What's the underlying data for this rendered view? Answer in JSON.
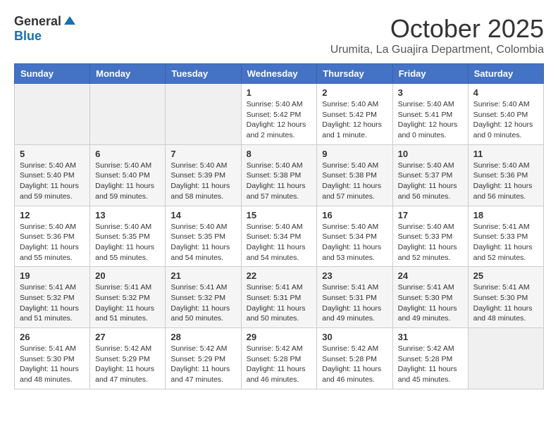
{
  "header": {
    "logo_general": "General",
    "logo_blue": "Blue",
    "month_title": "October 2025",
    "location": "Urumita, La Guajira Department, Colombia"
  },
  "weekdays": [
    "Sunday",
    "Monday",
    "Tuesday",
    "Wednesday",
    "Thursday",
    "Friday",
    "Saturday"
  ],
  "weeks": [
    [
      {
        "day": "",
        "info": ""
      },
      {
        "day": "",
        "info": ""
      },
      {
        "day": "",
        "info": ""
      },
      {
        "day": "1",
        "info": "Sunrise: 5:40 AM\nSunset: 5:42 PM\nDaylight: 12 hours\nand 2 minutes."
      },
      {
        "day": "2",
        "info": "Sunrise: 5:40 AM\nSunset: 5:42 PM\nDaylight: 12 hours\nand 1 minute."
      },
      {
        "day": "3",
        "info": "Sunrise: 5:40 AM\nSunset: 5:41 PM\nDaylight: 12 hours\nand 0 minutes."
      },
      {
        "day": "4",
        "info": "Sunrise: 5:40 AM\nSunset: 5:40 PM\nDaylight: 12 hours\nand 0 minutes."
      }
    ],
    [
      {
        "day": "5",
        "info": "Sunrise: 5:40 AM\nSunset: 5:40 PM\nDaylight: 11 hours\nand 59 minutes."
      },
      {
        "day": "6",
        "info": "Sunrise: 5:40 AM\nSunset: 5:40 PM\nDaylight: 11 hours\nand 59 minutes."
      },
      {
        "day": "7",
        "info": "Sunrise: 5:40 AM\nSunset: 5:39 PM\nDaylight: 11 hours\nand 58 minutes."
      },
      {
        "day": "8",
        "info": "Sunrise: 5:40 AM\nSunset: 5:38 PM\nDaylight: 11 hours\nand 57 minutes."
      },
      {
        "day": "9",
        "info": "Sunrise: 5:40 AM\nSunset: 5:38 PM\nDaylight: 11 hours\nand 57 minutes."
      },
      {
        "day": "10",
        "info": "Sunrise: 5:40 AM\nSunset: 5:37 PM\nDaylight: 11 hours\nand 56 minutes."
      },
      {
        "day": "11",
        "info": "Sunrise: 5:40 AM\nSunset: 5:36 PM\nDaylight: 11 hours\nand 56 minutes."
      }
    ],
    [
      {
        "day": "12",
        "info": "Sunrise: 5:40 AM\nSunset: 5:36 PM\nDaylight: 11 hours\nand 55 minutes."
      },
      {
        "day": "13",
        "info": "Sunrise: 5:40 AM\nSunset: 5:35 PM\nDaylight: 11 hours\nand 55 minutes."
      },
      {
        "day": "14",
        "info": "Sunrise: 5:40 AM\nSunset: 5:35 PM\nDaylight: 11 hours\nand 54 minutes."
      },
      {
        "day": "15",
        "info": "Sunrise: 5:40 AM\nSunset: 5:34 PM\nDaylight: 11 hours\nand 54 minutes."
      },
      {
        "day": "16",
        "info": "Sunrise: 5:40 AM\nSunset: 5:34 PM\nDaylight: 11 hours\nand 53 minutes."
      },
      {
        "day": "17",
        "info": "Sunrise: 5:40 AM\nSunset: 5:33 PM\nDaylight: 11 hours\nand 52 minutes."
      },
      {
        "day": "18",
        "info": "Sunrise: 5:41 AM\nSunset: 5:33 PM\nDaylight: 11 hours\nand 52 minutes."
      }
    ],
    [
      {
        "day": "19",
        "info": "Sunrise: 5:41 AM\nSunset: 5:32 PM\nDaylight: 11 hours\nand 51 minutes."
      },
      {
        "day": "20",
        "info": "Sunrise: 5:41 AM\nSunset: 5:32 PM\nDaylight: 11 hours\nand 51 minutes."
      },
      {
        "day": "21",
        "info": "Sunrise: 5:41 AM\nSunset: 5:32 PM\nDaylight: 11 hours\nand 50 minutes."
      },
      {
        "day": "22",
        "info": "Sunrise: 5:41 AM\nSunset: 5:31 PM\nDaylight: 11 hours\nand 50 minutes."
      },
      {
        "day": "23",
        "info": "Sunrise: 5:41 AM\nSunset: 5:31 PM\nDaylight: 11 hours\nand 49 minutes."
      },
      {
        "day": "24",
        "info": "Sunrise: 5:41 AM\nSunset: 5:30 PM\nDaylight: 11 hours\nand 49 minutes."
      },
      {
        "day": "25",
        "info": "Sunrise: 5:41 AM\nSunset: 5:30 PM\nDaylight: 11 hours\nand 48 minutes."
      }
    ],
    [
      {
        "day": "26",
        "info": "Sunrise: 5:41 AM\nSunset: 5:30 PM\nDaylight: 11 hours\nand 48 minutes."
      },
      {
        "day": "27",
        "info": "Sunrise: 5:42 AM\nSunset: 5:29 PM\nDaylight: 11 hours\nand 47 minutes."
      },
      {
        "day": "28",
        "info": "Sunrise: 5:42 AM\nSunset: 5:29 PM\nDaylight: 11 hours\nand 47 minutes."
      },
      {
        "day": "29",
        "info": "Sunrise: 5:42 AM\nSunset: 5:28 PM\nDaylight: 11 hours\nand 46 minutes."
      },
      {
        "day": "30",
        "info": "Sunrise: 5:42 AM\nSunset: 5:28 PM\nDaylight: 11 hours\nand 46 minutes."
      },
      {
        "day": "31",
        "info": "Sunrise: 5:42 AM\nSunset: 5:28 PM\nDaylight: 11 hours\nand 45 minutes."
      },
      {
        "day": "",
        "info": ""
      }
    ]
  ]
}
